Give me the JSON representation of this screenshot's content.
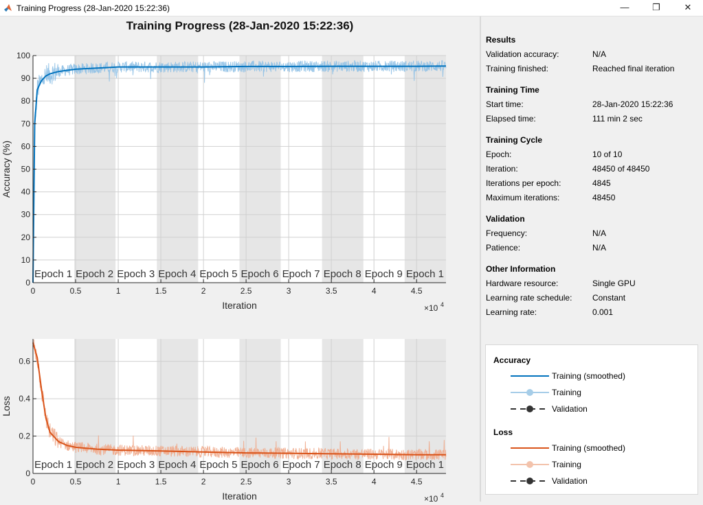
{
  "window": {
    "title": "Training Progress (28-Jan-2020 15:22:36)",
    "minimize_glyph": "—",
    "maximize_glyph": "❐",
    "close_glyph": "✕"
  },
  "figure_title": "Training Progress (28-Jan-2020 15:22:36)",
  "panel": {
    "sections": [
      {
        "title": "Results",
        "rows": [
          {
            "label": "Validation accuracy:",
            "value": "N/A"
          },
          {
            "label": "Training finished:",
            "value": "Reached final iteration"
          }
        ]
      },
      {
        "title": "Training Time",
        "rows": [
          {
            "label": "Start time:",
            "value": "28-Jan-2020 15:22:36"
          },
          {
            "label": "Elapsed time:",
            "value": "111 min 2 sec"
          }
        ]
      },
      {
        "title": "Training Cycle",
        "rows": [
          {
            "label": "Epoch:",
            "value": "10 of 10"
          },
          {
            "label": "Iteration:",
            "value": "48450 of 48450"
          },
          {
            "label": "Iterations per epoch:",
            "value": "4845"
          },
          {
            "label": "Maximum iterations:",
            "value": "48450"
          }
        ]
      },
      {
        "title": "Validation",
        "rows": [
          {
            "label": "Frequency:",
            "value": "N/A"
          },
          {
            "label": "Patience:",
            "value": "N/A"
          }
        ]
      },
      {
        "title": "Other Information",
        "rows": [
          {
            "label": "Hardware resource:",
            "value": "Single GPU"
          },
          {
            "label": "Learning rate schedule:",
            "value": "Constant"
          },
          {
            "label": "Learning rate:",
            "value": "0.001"
          }
        ]
      }
    ]
  },
  "legend": {
    "groups": [
      {
        "title": "Accuracy",
        "items": [
          {
            "label": "Training (smoothed)",
            "style": "line",
            "color": "#0072bd"
          },
          {
            "label": "Training",
            "style": "line-marker",
            "color": "#a6cde8"
          },
          {
            "label": "Validation",
            "style": "dashed-marker",
            "color": "#333333"
          }
        ]
      },
      {
        "title": "Loss",
        "items": [
          {
            "label": "Training (smoothed)",
            "style": "line",
            "color": "#d95319"
          },
          {
            "label": "Training",
            "style": "line-marker",
            "color": "#f3c3ac"
          },
          {
            "label": "Validation",
            "style": "dashed-marker",
            "color": "#333333"
          }
        ]
      }
    ]
  },
  "colors": {
    "accuracy_smoothed": "#0072bd",
    "accuracy_raw": "#8ec0e6",
    "loss_smoothed": "#d95319",
    "loss_raw": "#f0a98a",
    "epoch_band_shaded": "#e6e6e6",
    "epoch_band_plain": "#ffffff"
  },
  "chart_data": [
    {
      "type": "line",
      "xlabel": "Iteration",
      "ylabel": "Accuracy (%)",
      "xlim": [
        0,
        48450
      ],
      "ylim": [
        0,
        100
      ],
      "x_ticks": [
        0,
        5000,
        10000,
        15000,
        20000,
        25000,
        30000,
        35000,
        40000,
        45000
      ],
      "x_tick_labels": [
        "0",
        "0.5",
        "1",
        "1.5",
        "2",
        "2.5",
        "3",
        "3.5",
        "4",
        "4.5"
      ],
      "x_exponent_label": "×10",
      "x_exponent_power": "4",
      "y_ticks": [
        0,
        10,
        20,
        30,
        40,
        50,
        60,
        70,
        80,
        90,
        100
      ],
      "y_tick_labels": [
        "0",
        "10",
        "20",
        "30",
        "40",
        "50",
        "60",
        "70",
        "80",
        "90",
        "100"
      ],
      "grid": true,
      "epoch_labels": [
        "Epoch 1",
        "Epoch 2",
        "Epoch 3",
        "Epoch 4",
        "Epoch 5",
        "Epoch 6",
        "Epoch 7",
        "Epoch 8",
        "Epoch 9",
        "Epoch 1"
      ],
      "epoch_length": 4845,
      "series": [
        {
          "name": "Training (smoothed)",
          "x": [
            0,
            200,
            500,
            1000,
            1500,
            2000,
            3000,
            4000,
            5000,
            7500,
            10000,
            15000,
            20000,
            25000,
            30000,
            35000,
            40000,
            45000,
            48450
          ],
          "values": [
            0,
            70,
            85,
            89,
            91,
            92,
            93,
            93.5,
            94,
            94.5,
            95,
            95,
            95,
            95.2,
            95.2,
            95.3,
            95.3,
            95.3,
            95.4
          ]
        }
      ]
    },
    {
      "type": "line",
      "xlabel": "Iteration",
      "ylabel": "Loss",
      "xlim": [
        0,
        48450
      ],
      "ylim": [
        0,
        0.72
      ],
      "x_ticks": [
        0,
        5000,
        10000,
        15000,
        20000,
        25000,
        30000,
        35000,
        40000,
        45000
      ],
      "x_tick_labels": [
        "0",
        "0.5",
        "1",
        "1.5",
        "2",
        "2.5",
        "3",
        "3.5",
        "4",
        "4.5"
      ],
      "x_exponent_label": "×10",
      "x_exponent_power": "4",
      "y_ticks": [
        0,
        0.2,
        0.4,
        0.6
      ],
      "y_tick_labels": [
        "0",
        "0.2",
        "0.4",
        "0.6"
      ],
      "grid": true,
      "epoch_labels": [
        "Epoch 1",
        "Epoch 2",
        "Epoch 3",
        "Epoch 4",
        "Epoch 5",
        "Epoch 6",
        "Epoch 7",
        "Epoch 8",
        "Epoch 9",
        "Epoch 1"
      ],
      "epoch_length": 4845,
      "series": [
        {
          "name": "Training (smoothed)",
          "x": [
            0,
            500,
            1000,
            1500,
            2000,
            3000,
            4000,
            5000,
            7500,
            10000,
            15000,
            20000,
            25000,
            30000,
            35000,
            40000,
            45000,
            48450
          ],
          "values": [
            0.7,
            0.62,
            0.45,
            0.3,
            0.22,
            0.17,
            0.15,
            0.14,
            0.13,
            0.125,
            0.12,
            0.115,
            0.11,
            0.108,
            0.105,
            0.103,
            0.1,
            0.1
          ]
        }
      ]
    }
  ]
}
